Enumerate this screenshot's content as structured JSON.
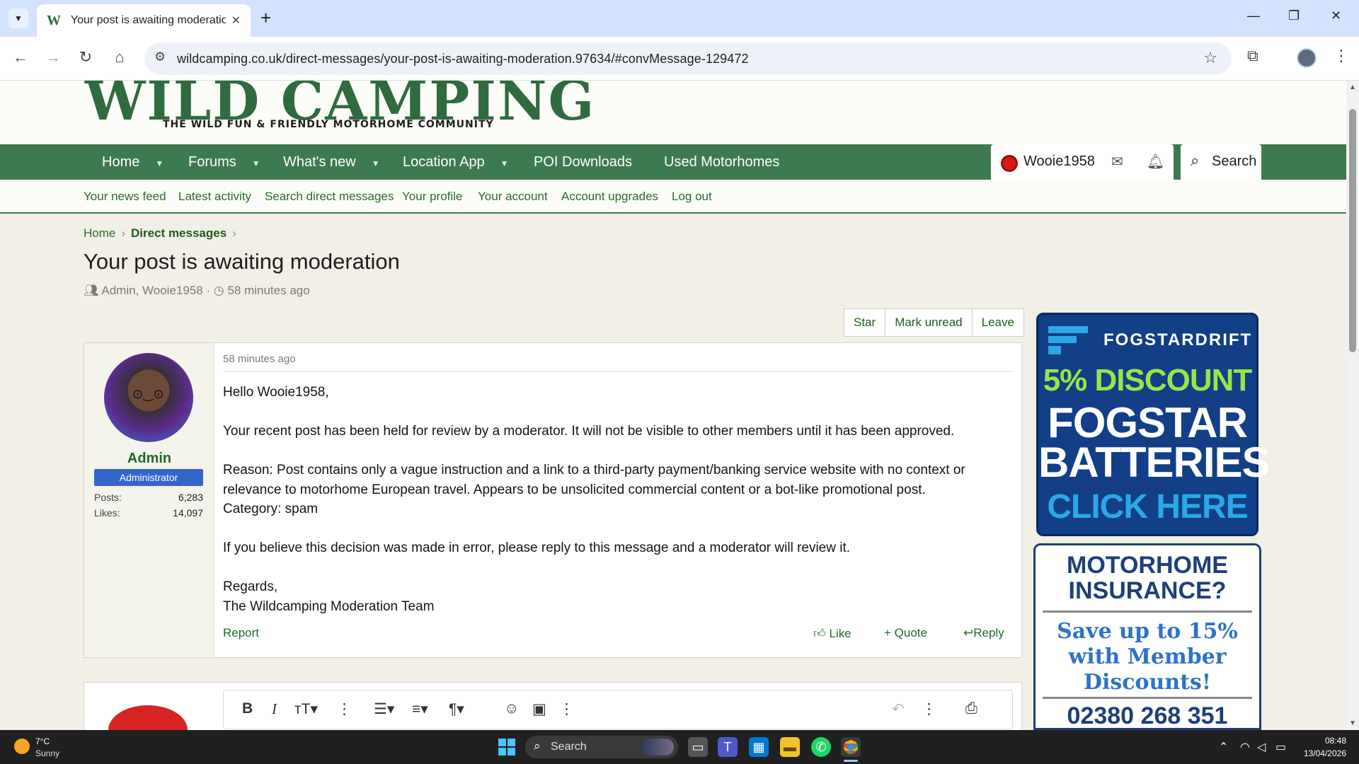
{
  "browser": {
    "tab_title": "Your post is awaiting moderatio",
    "favicon": "W",
    "url": "wildcamping.co.uk/direct-messages/your-post-is-awaiting-moderation.97634/#convMessage-129472"
  },
  "site": {
    "logo_text": "WILD CAMPING",
    "tagline": "THE WILD FUN & FRIENDLY MOTORHOME COMMUNITY"
  },
  "nav": {
    "items": [
      {
        "label": "Home"
      },
      {
        "label": "Forums"
      },
      {
        "label": "What's new"
      },
      {
        "label": "Location App"
      },
      {
        "label": "POI Downloads"
      },
      {
        "label": "Used Motorhomes"
      }
    ],
    "username": "Wooie1958",
    "search_label": "Search"
  },
  "subnav": {
    "items": [
      {
        "label": "Your news feed"
      },
      {
        "label": "Latest activity"
      },
      {
        "label": "Search direct messages"
      },
      {
        "label": "Your profile"
      },
      {
        "label": "Your account"
      },
      {
        "label": "Account upgrades"
      },
      {
        "label": "Log out"
      }
    ]
  },
  "breadcrumb": {
    "home": "Home",
    "current": "Direct messages"
  },
  "conversation": {
    "title": "Your post is awaiting moderation",
    "participants": "Admin, Wooie1958",
    "time": "58 minutes ago",
    "actions": {
      "star": "Star",
      "mark_unread": "Mark unread",
      "leave": "Leave"
    }
  },
  "message": {
    "author": "Admin",
    "user_title": "Administrator",
    "posts_label": "Posts:",
    "posts": "6,283",
    "likes_label": "Likes:",
    "likes": "14,097",
    "time": "58 minutes ago",
    "greeting": "Hello Wooie1958,",
    "para1": "Your recent post has been held for review by a moderator. It will not be visible to other members until it has been approved.",
    "reason": "Reason: Post contains only a vague instruction and a link to a third-party payment/banking service website with no context or relevance to motorhome European travel. Appears to be unsolicited commercial content or a bot-like promotional post.",
    "category": "Category: spam",
    "para3": "If you believe this decision was made in error, please reply to this message and a moderator will review it.",
    "signoff": "Regards,",
    "team": "The Wildcamping Moderation Team",
    "report": "Report",
    "like": "Like",
    "quote": "Quote",
    "reply": "Reply"
  },
  "ads": {
    "fogstar": {
      "brand": "FOGSTARDRIFT",
      "discount": "5% DISCOUNT",
      "line1": "FOGSTAR",
      "line2": "BATTERIES",
      "cta": "CLICK HERE"
    },
    "insurance": {
      "heading1": "MOTORHOME",
      "heading2": "INSURANCE?",
      "offer1": "Save up to 15%",
      "offer2": "with Member",
      "offer3": "Discounts!",
      "phone": "02380 268 351"
    }
  },
  "taskbar": {
    "temp": "7°C",
    "condition": "Sunny",
    "search": "Search",
    "time": "08:48",
    "date": "13/04/2026"
  }
}
